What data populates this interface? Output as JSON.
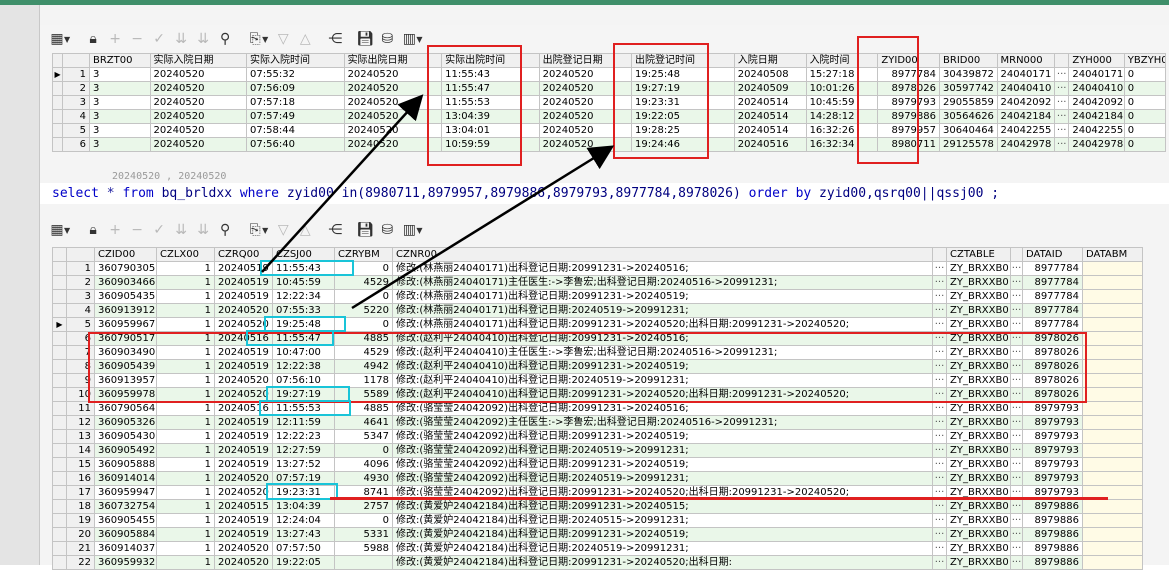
{
  "top_table": {
    "columns": [
      "",
      "",
      "BRZT00",
      "实际入院日期",
      "实际入院时间",
      "实际出院日期",
      "实际出院时间",
      "出院登记日期",
      "出院登记时间",
      "入院日期",
      "入院时间",
      "ZYID00",
      "BRID00",
      "MRN000",
      "",
      "ZYH000",
      "YBZYH0"
    ],
    "rows": [
      {
        "n": "1",
        "brzt": "3",
        "sjrq": "20240520",
        "sjsj": "07:55:32",
        "cyrq": "20240520",
        "cysj": "11:55:43",
        "djrq": "20240520",
        "djsj": "19:25:48",
        "ryrq": "20240508",
        "rysj": "15:27:18",
        "zyid": "8977784",
        "brid": "30439872",
        "mrn": "24040171",
        "zyh": "24040171",
        "yb": "0"
      },
      {
        "n": "2",
        "brzt": "3",
        "sjrq": "20240520",
        "sjsj": "07:56:09",
        "cyrq": "20240520",
        "cysj": "11:55:47",
        "djrq": "20240520",
        "djsj": "19:27:19",
        "ryrq": "20240509",
        "rysj": "10:01:26",
        "zyid": "8978026",
        "brid": "30597742",
        "mrn": "24040410",
        "zyh": "24040410",
        "yb": "0"
      },
      {
        "n": "3",
        "brzt": "3",
        "sjrq": "20240520",
        "sjsj": "07:57:18",
        "cyrq": "20240520",
        "cysj": "11:55:53",
        "djrq": "20240520",
        "djsj": "19:23:31",
        "ryrq": "20240514",
        "rysj": "10:45:59",
        "zyid": "8979793",
        "brid": "29055859",
        "mrn": "24042092",
        "zyh": "24042092",
        "yb": "0"
      },
      {
        "n": "4",
        "brzt": "3",
        "sjrq": "20240520",
        "sjsj": "07:57:49",
        "cyrq": "20240520",
        "cysj": "13:04:39",
        "djrq": "20240520",
        "djsj": "19:22:05",
        "ryrq": "20240514",
        "rysj": "14:28:12",
        "zyid": "8979886",
        "brid": "30564626",
        "mrn": "24042184",
        "zyh": "24042184",
        "yb": "0"
      },
      {
        "n": "5",
        "brzt": "3",
        "sjrq": "20240520",
        "sjsj": "07:58:44",
        "cyrq": "20240520",
        "cysj": "13:04:01",
        "djrq": "20240520",
        "djsj": "19:28:25",
        "ryrq": "20240514",
        "rysj": "16:32:26",
        "zyid": "8979957",
        "brid": "30640464",
        "mrn": "24042255",
        "zyh": "24042255",
        "yb": "0"
      },
      {
        "n": "6",
        "brzt": "3",
        "sjrq": "20240520",
        "sjsj": "07:56:40",
        "cyrq": "20240520",
        "cysj": "10:59:59",
        "djrq": "20240520",
        "djsj": "19:24:46",
        "ryrq": "20240516",
        "rysj": "16:32:34",
        "zyid": "8980711",
        "brid": "29125578",
        "mrn": "24042978",
        "zyh": "24042978",
        "yb": "0"
      }
    ]
  },
  "faded_text": "20240520 , 20240520",
  "sql": {
    "select": "select",
    "star": " * ",
    "from": "from",
    "table": " bq_brldxx ",
    "where": "where",
    "rest": " zyid00 in(8980711,8979957,8979886,8979793,8977784,8978026) ",
    "order": "order by",
    "tail": " zyid00,qsrq00||qssj00 ;"
  },
  "bottom_table": {
    "columns": [
      "",
      "",
      "CZID00",
      "CZLX00",
      "CZRQ00",
      "CZSJ00",
      "CZRYBM",
      "CZNR00",
      "",
      "CZTABLE",
      "",
      "DATAID",
      "DATABM"
    ],
    "rows": [
      {
        "n": "1",
        "czid": "360790305",
        "czlx": "1",
        "czrq": "20240519",
        "czsj": "11:55:43",
        "czry": "0",
        "cznr": "修改:(林燕丽24040171)出科登记日期:20991231->20240516;",
        "tbl": "ZY_BRXXB0",
        "did": "8977784"
      },
      {
        "n": "2",
        "czid": "360903466",
        "czlx": "1",
        "czrq": "20240519",
        "czsj": "10:45:59",
        "czry": "4529",
        "cznr": "修改:(林燕丽24040171)主任医生:->李鲁宏;出科登记日期:20240516->20991231;",
        "tbl": "ZY_BRXXB0",
        "did": "8977784"
      },
      {
        "n": "3",
        "czid": "360905435",
        "czlx": "1",
        "czrq": "20240519",
        "czsj": "12:22:34",
        "czry": "0",
        "cznr": "修改:(林燕丽24040171)出科登记日期:20991231->20240519;",
        "tbl": "ZY_BRXXB0",
        "did": "8977784"
      },
      {
        "n": "4",
        "czid": "360913912",
        "czlx": "1",
        "czrq": "20240520",
        "czsj": "07:55:33",
        "czry": "5220",
        "cznr": "修改:(林燕丽24040171)出科登记日期:20240519->20991231;",
        "tbl": "ZY_BRXXB0",
        "did": "8977784"
      },
      {
        "n": "5",
        "czid": "360959967",
        "czlx": "1",
        "czrq": "20240520",
        "czsj": "19:25:48",
        "czry": "0",
        "cznr": "修改:(林燕丽24040171)出科登记日期:20991231->20240520;出科日期:20991231->20240520;",
        "tbl": "ZY_BRXXB0",
        "did": "8977784"
      },
      {
        "n": "6",
        "czid": "360790517",
        "czlx": "1",
        "czrq": "20240516",
        "czsj": "11:55:47",
        "czry": "4885",
        "cznr": "修改:(赵利平24040410)出科登记日期:20991231->20240516;",
        "tbl": "ZY_BRXXB0",
        "did": "8978026"
      },
      {
        "n": "7",
        "czid": "360903490",
        "czlx": "1",
        "czrq": "20240519",
        "czsj": "10:47:00",
        "czry": "4529",
        "cznr": "修改:(赵利平24040410)主任医生:->李鲁宏;出科登记日期:20240516->20991231;",
        "tbl": "ZY_BRXXB0",
        "did": "8978026"
      },
      {
        "n": "8",
        "czid": "360905439",
        "czlx": "1",
        "czrq": "20240519",
        "czsj": "12:22:38",
        "czry": "4942",
        "cznr": "修改:(赵利平24040410)出科登记日期:20991231->20240519;",
        "tbl": "ZY_BRXXB0",
        "did": "8978026"
      },
      {
        "n": "9",
        "czid": "360913957",
        "czlx": "1",
        "czrq": "20240520",
        "czsj": "07:56:10",
        "czry": "1178",
        "cznr": "修改:(赵利平24040410)出科登记日期:20240519->20991231;",
        "tbl": "ZY_BRXXB0",
        "did": "8978026"
      },
      {
        "n": "10",
        "czid": "360959978",
        "czlx": "1",
        "czrq": "20240520",
        "czsj": "19:27:19",
        "czry": "5589",
        "cznr": "修改:(赵利平24040410)出科登记日期:20991231->20240520;出科日期:20991231->20240520;",
        "tbl": "ZY_BRXXB0",
        "did": "8978026"
      },
      {
        "n": "11",
        "czid": "360790564",
        "czlx": "1",
        "czrq": "20240516",
        "czsj": "11:55:53",
        "czry": "4885",
        "cznr": "修改:(骆莹莹24042092)出科登记日期:20991231->20240516;",
        "tbl": "ZY_BRXXB0",
        "did": "8979793"
      },
      {
        "n": "12",
        "czid": "360905326",
        "czlx": "1",
        "czrq": "20240519",
        "czsj": "12:11:59",
        "czry": "4641",
        "cznr": "修改:(骆莹莹24042092)主任医生:->李鲁宏;出科登记日期:20240516->20991231;",
        "tbl": "ZY_BRXXB0",
        "did": "8979793"
      },
      {
        "n": "13",
        "czid": "360905430",
        "czlx": "1",
        "czrq": "20240519",
        "czsj": "12:22:23",
        "czry": "5347",
        "cznr": "修改:(骆莹莹24042092)出科登记日期:20991231->20240519;",
        "tbl": "ZY_BRXXB0",
        "did": "8979793"
      },
      {
        "n": "14",
        "czid": "360905492",
        "czlx": "1",
        "czrq": "20240519",
        "czsj": "12:27:59",
        "czry": "0",
        "cznr": "修改:(骆莹莹24042092)出科登记日期:20240519->20991231;",
        "tbl": "ZY_BRXXB0",
        "did": "8979793"
      },
      {
        "n": "15",
        "czid": "360905888",
        "czlx": "1",
        "czrq": "20240519",
        "czsj": "13:27:52",
        "czry": "4096",
        "cznr": "修改:(骆莹莹24042092)出科登记日期:20991231->20240519;",
        "tbl": "ZY_BRXXB0",
        "did": "8979793"
      },
      {
        "n": "16",
        "czid": "360914014",
        "czlx": "1",
        "czrq": "20240520",
        "czsj": "07:57:19",
        "czry": "4930",
        "cznr": "修改:(骆莹莹24042092)出科登记日期:20240519->20991231;",
        "tbl": "ZY_BRXXB0",
        "did": "8979793"
      },
      {
        "n": "17",
        "czid": "360959947",
        "czlx": "1",
        "czrq": "20240520",
        "czsj": "19:23:31",
        "czry": "8741",
        "cznr": "修改:(骆莹莹24042092)出科登记日期:20991231->20240520;出科日期:20991231->20240520;",
        "tbl": "ZY_BRXXB0",
        "did": "8979793"
      },
      {
        "n": "18",
        "czid": "360732754",
        "czlx": "1",
        "czrq": "20240515",
        "czsj": "13:04:39",
        "czry": "2757",
        "cznr": "修改:(黄爱妒24042184)出科登记日期:20991231->20240515;",
        "tbl": "ZY_BRXXB0",
        "did": "8979886"
      },
      {
        "n": "19",
        "czid": "360905455",
        "czlx": "1",
        "czrq": "20240519",
        "czsj": "12:24:04",
        "czry": "0",
        "cznr": "修改:(黄爱妒24042184)出科登记日期:20240515->20991231;",
        "tbl": "ZY_BRXXB0",
        "did": "8979886"
      },
      {
        "n": "20",
        "czid": "360905884",
        "czlx": "1",
        "czrq": "20240519",
        "czsj": "13:27:43",
        "czry": "5331",
        "cznr": "修改:(黄爱妒24042184)出科登记日期:20991231->20240519;",
        "tbl": "ZY_BRXXB0",
        "did": "8979886"
      },
      {
        "n": "21",
        "czid": "360914037",
        "czlx": "1",
        "czrq": "20240520",
        "czsj": "07:57:50",
        "czry": "5988",
        "cznr": "修改:(黄爱妒24042184)出科登记日期:20240519->20991231;",
        "tbl": "ZY_BRXXB0",
        "did": "8979886"
      },
      {
        "n": "22",
        "czid": "360959932",
        "czlx": "1",
        "czrq": "20240520",
        "czsj": "19:22:05",
        "czry": "",
        "cznr": "修改:(黄爱妒24042184)出科登记日期:20991231->20240520;出科日期:",
        "tbl": "ZY_BRXXB0",
        "did": "8979886"
      }
    ]
  },
  "icons": [
    "grid-icon",
    "lock-icon",
    "plus-icon",
    "minus-icon",
    "check-icon",
    "filter-down-icon",
    "filter-all-icon",
    "binoculars-icon",
    "export-icon",
    "triangle-down-icon",
    "triangle-up-icon",
    "tree-icon",
    "save-icon",
    "print-icon",
    "chart-icon"
  ],
  "colors": {
    "highlight_red": "#e02020",
    "highlight_cyan": "#19c4d8",
    "row_alt": "#eaf7e9"
  }
}
